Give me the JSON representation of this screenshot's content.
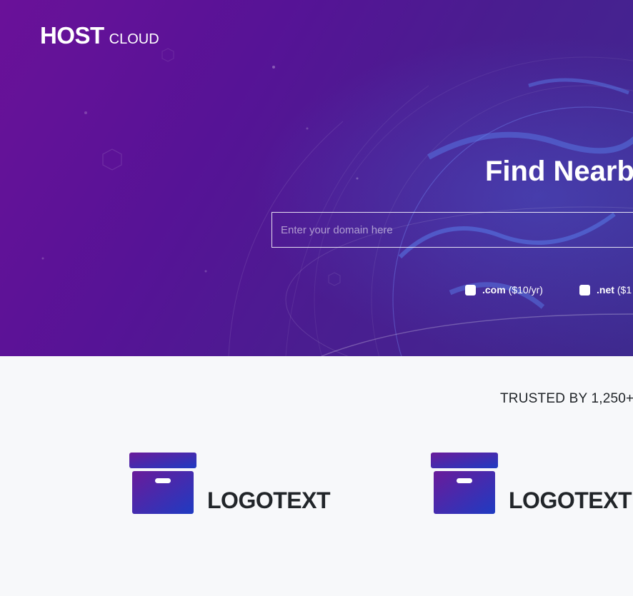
{
  "brand": {
    "main": "HOST",
    "sub": "CLOUD"
  },
  "hero": {
    "title": "Find Nearb",
    "search_placeholder": "Enter your domain here"
  },
  "tlds": [
    {
      "name": ".com",
      "price": "($10/yr)"
    },
    {
      "name": ".net",
      "price": "($1"
    }
  ],
  "trusted": {
    "text": "TRUSTED BY 1,250+"
  },
  "clients": [
    {
      "label": "LOGOTEXT",
      "icon": "archive-box-icon"
    },
    {
      "label": "LOGOTEXT",
      "icon": "archive-box-icon"
    }
  ],
  "colors": {
    "hero_gradient_start": "#6a1199",
    "hero_gradient_end": "#3e2a8f",
    "logo_gradient_start": "#6a1b9a",
    "logo_gradient_end": "#1f3bc2",
    "text_dark": "#212529"
  }
}
